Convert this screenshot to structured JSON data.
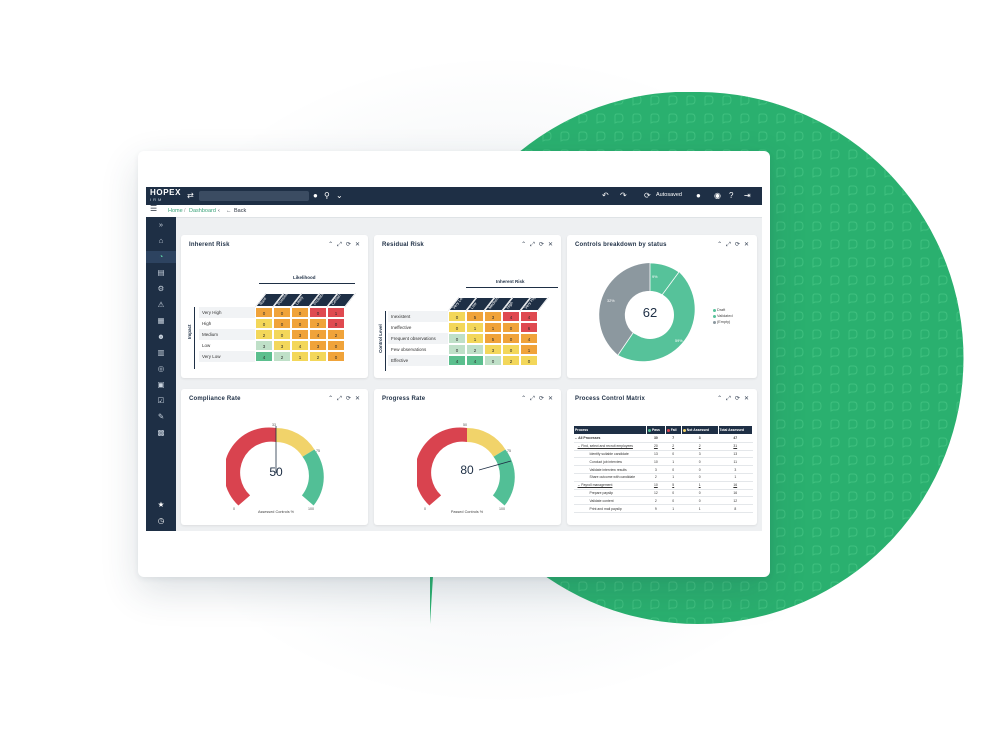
{
  "topbar": {
    "brand_main": "HOPEX",
    "brand_sub": "IRM",
    "autosave_label": "Autosaved"
  },
  "breadcrumb": {
    "home": "Home",
    "separator": "/",
    "current": "Dashboard",
    "back": "Back"
  },
  "panels": {
    "inherent": {
      "title": "Inherent Risk",
      "col_axis": "Likelihood",
      "row_axis": "Impact",
      "cols": [
        "Rare",
        "Possible",
        "Likely",
        "Probable",
        "Certain"
      ],
      "rows": [
        {
          "label": "Very High",
          "cells": [
            "0",
            "0",
            "0",
            "0",
            "1"
          ]
        },
        {
          "label": "High",
          "cells": [
            "0",
            "0",
            "0",
            "2",
            "0"
          ]
        },
        {
          "label": "Medium",
          "cells": [
            "2",
            "0",
            "3",
            "4",
            "2"
          ]
        },
        {
          "label": "Low",
          "cells": [
            "3",
            "3",
            "4",
            "3",
            "0"
          ]
        },
        {
          "label": "Very Low",
          "cells": [
            "4",
            "2",
            "1",
            "2",
            "0"
          ]
        }
      ]
    },
    "residual": {
      "title": "Residual Risk",
      "col_axis": "Inherent Risk",
      "row_axis": "Control Level",
      "cols": [
        "Very Low",
        "Low",
        "Medium",
        "High",
        "Very High"
      ],
      "rows": [
        {
          "label": "Inexistent",
          "cells": [
            "0",
            "5",
            "3",
            "4",
            "4"
          ]
        },
        {
          "label": "Ineffective",
          "cells": [
            "0",
            "1",
            "1",
            "0",
            "6"
          ]
        },
        {
          "label": "Frequent observations",
          "cells": [
            "0",
            "1",
            "5",
            "0",
            "4"
          ]
        },
        {
          "label": "Few observations",
          "cells": [
            "0",
            "2",
            "3",
            "0",
            "1"
          ]
        },
        {
          "label": "Effective",
          "cells": [
            "4",
            "4",
            "0",
            "2",
            "0"
          ]
        }
      ]
    },
    "controls": {
      "title": "Controls breakdown by status",
      "center_value": "62",
      "legend": [
        "Draft",
        "Validated",
        "(Empty)"
      ],
      "slice_labels": [
        "9%",
        "59%",
        "32%"
      ]
    },
    "compliance": {
      "title": "Compliance Rate",
      "value": "50",
      "ticks": [
        "0",
        "33",
        "75",
        "100"
      ],
      "caption": "Assessed Controls %"
    },
    "progress": {
      "title": "Progress Rate",
      "value": "80",
      "ticks": [
        "0",
        "50",
        "75",
        "100"
      ],
      "caption": "Passed Controls %"
    },
    "pcm": {
      "title": "Process Control Matrix",
      "headers": [
        "Process",
        "Pass",
        "Fail",
        "Not Assessed",
        "Total Assessed"
      ],
      "rows": [
        {
          "name": "All Processes",
          "v": [
            "30",
            "7",
            "3",
            "47"
          ]
        },
        {
          "name": "Find, select and recruit employees",
          "v": [
            "20",
            "2",
            "2",
            "31"
          ]
        },
        {
          "name": "Identify suitable candidate",
          "v": [
            "13",
            "0",
            "3",
            "13"
          ]
        },
        {
          "name": "Conduct job interview",
          "v": [
            "10",
            "1",
            "0",
            "11"
          ]
        },
        {
          "name": "Validate interview results",
          "v": [
            "3",
            "0",
            "0",
            "3"
          ]
        },
        {
          "name": "Share outcome with candidate",
          "v": [
            "2",
            "1",
            "0",
            "1"
          ]
        },
        {
          "name": "Payroll management",
          "v": [
            "10",
            "5",
            "1",
            "16"
          ]
        },
        {
          "name": "Prepare payslip",
          "v": [
            "12",
            "0",
            "0",
            "16"
          ]
        },
        {
          "name": "Validate content",
          "v": [
            "2",
            "0",
            "0",
            "12"
          ]
        },
        {
          "name": "Print and mail payslip",
          "v": [
            "9",
            "1",
            "1",
            "8"
          ]
        }
      ]
    }
  },
  "colors": {
    "navy": "#1e2f45",
    "green_bg": "#2ab06f",
    "heat_green": "#5bbf8e",
    "heat_lightgreen": "#bfe0c8",
    "heat_yellow": "#f3d75a",
    "heat_orange": "#f0a33a",
    "heat_red": "#df4a50",
    "gauge_red": "#d9434f",
    "gauge_yellow": "#f1d36a",
    "gauge_green": "#52bf96"
  }
}
